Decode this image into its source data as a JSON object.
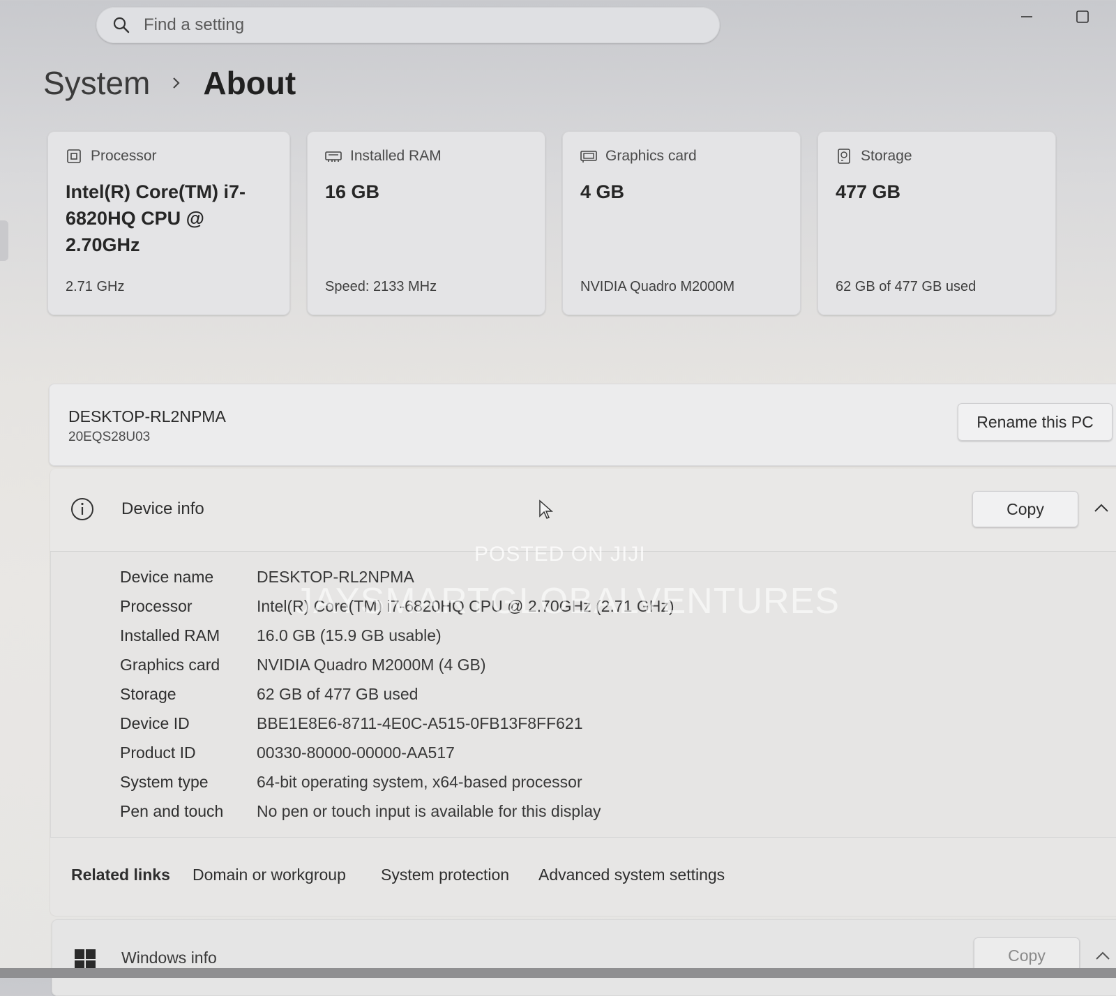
{
  "search": {
    "placeholder": "Find a setting"
  },
  "breadcrumb": {
    "parent": "System",
    "current": "About"
  },
  "cards": {
    "processor": {
      "label": "Processor",
      "value": "Intel(R) Core(TM) i7-6820HQ CPU @ 2.70GHz",
      "sub": "2.71 GHz"
    },
    "ram": {
      "label": "Installed RAM",
      "value": "16 GB",
      "sub": "Speed: 2133 MHz"
    },
    "gpu": {
      "label": "Graphics card",
      "value": "4 GB",
      "sub": "NVIDIA Quadro M2000M"
    },
    "storage": {
      "label": "Storage",
      "value": "477 GB",
      "sub": "62 GB of 477 GB used"
    }
  },
  "pc": {
    "name": "DESKTOP-RL2NPMA",
    "model": "20EQS28U03",
    "rename_label": "Rename this PC"
  },
  "device_info": {
    "title": "Device info",
    "copy_label": "Copy",
    "specs": [
      {
        "label": "Device name",
        "value": "DESKTOP-RL2NPMA"
      },
      {
        "label": "Processor",
        "value": "Intel(R) Core(TM) i7-6820HQ CPU @ 2.70GHz (2.71 GHz)"
      },
      {
        "label": "Installed RAM",
        "value": "16.0 GB (15.9 GB usable)"
      },
      {
        "label": "Graphics card",
        "value": "NVIDIA Quadro M2000M (4 GB)"
      },
      {
        "label": "Storage",
        "value": "62 GB of 477 GB used"
      },
      {
        "label": "Device ID",
        "value": "BBE1E8E6-8711-4E0C-A515-0FB13F8FF621"
      },
      {
        "label": "Product ID",
        "value": "00330-80000-00000-AA517"
      },
      {
        "label": "System type",
        "value": "64-bit operating system, x64-based processor"
      },
      {
        "label": "Pen and touch",
        "value": "No pen or touch input is available for this display"
      }
    ]
  },
  "related_links": {
    "title": "Related links",
    "links": [
      "Domain or workgroup",
      "System protection",
      "Advanced system settings"
    ]
  },
  "windows_info": {
    "title": "Windows info",
    "copy_label": "Copy"
  },
  "watermark": {
    "line1": "POSTED ON JIJI",
    "line2": "JAYSMARTGLOBALVENTURES"
  },
  "icons": {
    "search": "search-icon",
    "minimize": "minimize-icon",
    "maximize": "maximize-icon",
    "processor": "processor-icon",
    "ram": "ram-icon",
    "gpu": "graphics-card-icon",
    "storage": "storage-icon",
    "info": "info-icon",
    "chevron": "chevron-up-icon",
    "windows": "windows-logo-icon",
    "cursor": "mouse-cursor-icon"
  }
}
